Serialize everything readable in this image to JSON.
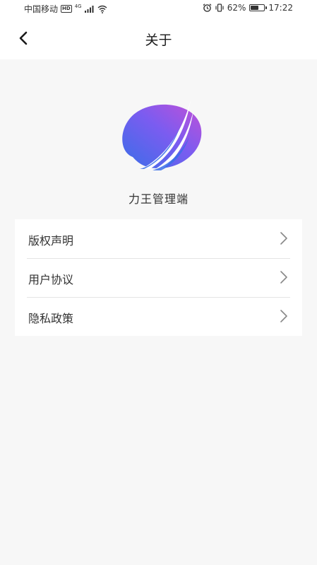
{
  "status_bar": {
    "carrier": "中国移动",
    "hd_badge": "HD",
    "network": "4G",
    "battery_percent": "62%",
    "battery_level": 0.62,
    "time": "17:22"
  },
  "header": {
    "title": "关于",
    "back_icon": "chevron-left-icon"
  },
  "app": {
    "name": "力王管理端",
    "logo_colors": [
      "#7b5cf0",
      "#3a6ee8",
      "#c050d8"
    ]
  },
  "menu": {
    "items": [
      {
        "label": "版权声明",
        "icon": "chevron-right-icon"
      },
      {
        "label": "用户协议",
        "icon": "chevron-right-icon"
      },
      {
        "label": "隐私政策",
        "icon": "chevron-right-icon"
      }
    ]
  }
}
